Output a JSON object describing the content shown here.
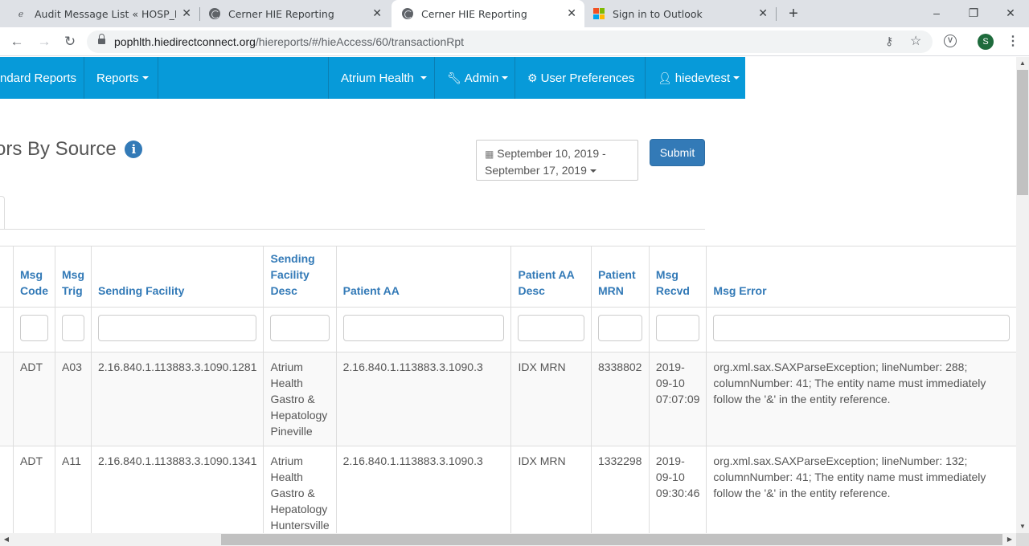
{
  "browser": {
    "tabs": [
      {
        "label": "Audit Message List « HOSP_MO",
        "icon": "edge-e-icon"
      },
      {
        "label": "Cerner HIE Reporting",
        "icon": "globe-icon"
      },
      {
        "label": "Cerner HIE Reporting",
        "icon": "globe-icon",
        "active": true
      },
      {
        "label": "Sign in to Outlook",
        "icon": "microsoft-logo-icon"
      }
    ],
    "url_host": "pophlth.hiedirectconnect.org",
    "url_path": "/hiereports/#/hieAccess/60/transactionRpt",
    "profile_initial": "S"
  },
  "navbar": {
    "items": [
      {
        "label": "ndard Reports"
      },
      {
        "label": "Reports"
      },
      {
        "label": "Atrium Health"
      },
      {
        "label": "Admin"
      },
      {
        "label": "User Preferences"
      },
      {
        "label": "hiedevtest"
      }
    ]
  },
  "page": {
    "title": "ors By Source",
    "date_range_line1": "September 10, 2019 -",
    "date_range_line2": "September 17, 2019",
    "submit_label": "Submit"
  },
  "table": {
    "columns": [
      {
        "lines": [
          "Msg",
          "Code"
        ]
      },
      {
        "lines": [
          "Msg",
          "Trig"
        ]
      },
      {
        "lines": [
          "Sending Facility"
        ]
      },
      {
        "lines": [
          "Sending",
          "Facility",
          "Desc"
        ]
      },
      {
        "lines": [
          "Patient AA"
        ]
      },
      {
        "lines": [
          "Patient AA",
          "Desc"
        ]
      },
      {
        "lines": [
          "Patient",
          "MRN"
        ]
      },
      {
        "lines": [
          "Msg",
          "Recvd"
        ]
      },
      {
        "lines": [
          "Msg Error"
        ]
      }
    ],
    "rows": [
      {
        "msg_code": "ADT",
        "msg_trig": "A03",
        "sending_facility": "2.16.840.1.113883.3.1090.1281",
        "sending_facility_desc": [
          "Atrium",
          "Health",
          "Gastro &",
          "Hepatology",
          "Pineville"
        ],
        "patient_aa": "2.16.840.1.113883.3.1090.3",
        "patient_aa_desc": "IDX MRN",
        "patient_mrn": "8338802",
        "msg_recvd": [
          "2019-",
          "09-10",
          "07:07:09"
        ],
        "msg_error": [
          "org.xml.sax.SAXParseException; lineNumber: 288;",
          "columnNumber: 41; The entity name must immediately",
          "follow the '&' in the entity reference."
        ]
      },
      {
        "msg_code": "ADT",
        "msg_trig": "A11",
        "sending_facility": "2.16.840.1.113883.3.1090.1341",
        "sending_facility_desc": [
          "Atrium",
          "Health",
          "Gastro &",
          "Hepatology",
          "Huntersville"
        ],
        "patient_aa": "2.16.840.1.113883.3.1090.3",
        "patient_aa_desc": "IDX MRN",
        "patient_mrn": "1332298",
        "msg_recvd": [
          "2019-",
          "09-10",
          "09:30:46"
        ],
        "msg_error": [
          "org.xml.sax.SAXParseException; lineNumber: 132;",
          "columnNumber: 41; The entity name must immediately",
          "follow the '&' in the entity reference."
        ]
      }
    ]
  }
}
